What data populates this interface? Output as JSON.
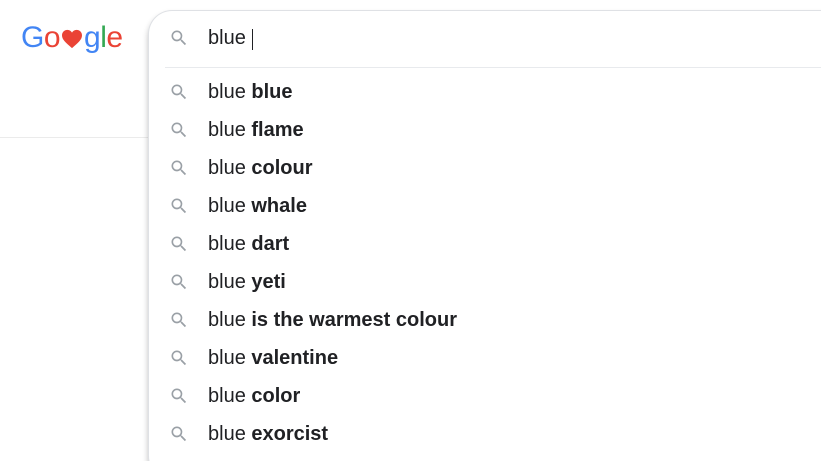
{
  "logo": {
    "letters": [
      "G",
      "o",
      "g",
      "l",
      "e"
    ],
    "heart_icon": "heart-icon",
    "colors": {
      "blue": "#4285f4",
      "red": "#ea4335",
      "yellow": "#fbbc05",
      "green": "#34a853",
      "heart": "#ea4335"
    }
  },
  "search": {
    "icon": "search-icon",
    "query": "blue",
    "icon_color": "#9aa0a6"
  },
  "suggestions": [
    {
      "prefix": "blue",
      "completion": "blue"
    },
    {
      "prefix": "blue",
      "completion": "flame"
    },
    {
      "prefix": "blue",
      "completion": "colour"
    },
    {
      "prefix": "blue",
      "completion": "whale"
    },
    {
      "prefix": "blue",
      "completion": "dart"
    },
    {
      "prefix": "blue",
      "completion": "yeti"
    },
    {
      "prefix": "blue",
      "completion": "is the warmest colour"
    },
    {
      "prefix": "blue",
      "completion": "valentine"
    },
    {
      "prefix": "blue",
      "completion": "color"
    },
    {
      "prefix": "blue",
      "completion": "exorcist"
    }
  ]
}
